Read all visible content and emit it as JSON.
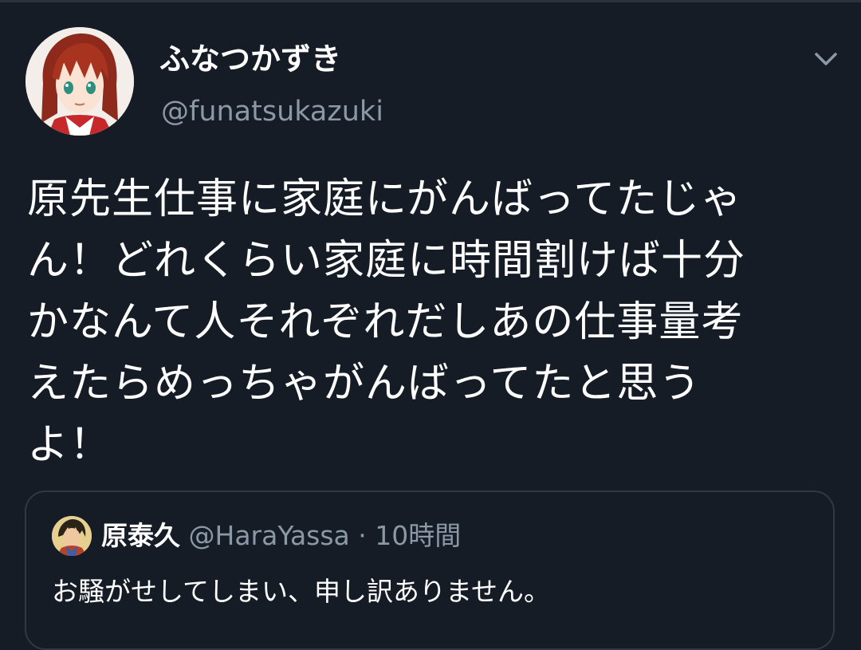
{
  "tweet": {
    "author_name": "ふなつかずき",
    "author_handle": "@funatsukazuki",
    "text": "原先生仕事に家庭にがんばってたじゃ\nん！どれくらい家庭に時間割けば十分\nかなんて人それぞれだしあの仕事量考\nえたらめっちゃがんばってたと思う\nよ！",
    "menu_icon": "chevron-down-icon"
  },
  "quote": {
    "author_name": "原泰久",
    "author_handle": "@HaraYassa",
    "separator": "·",
    "time": "10時間",
    "text": "お騒がせしてしまい、申し訳ありません。"
  },
  "colors": {
    "background": "#151c26",
    "primary_text": "#ffffff",
    "secondary_text": "#8b98a5",
    "border": "#2f3843"
  }
}
